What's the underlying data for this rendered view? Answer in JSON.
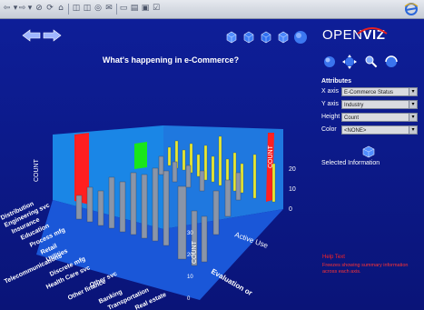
{
  "colors": {
    "background": "#0b1a8c",
    "wall_back": "#1d8fe8",
    "floor": "#1556d6",
    "red_block": "#ff1a1a",
    "green_block": "#19e61a",
    "yellow_bar": "#e8ea3a",
    "gray_bar": "#8a95a8",
    "help_red": "#ff2222"
  },
  "toolbar": {
    "back_icon": "back-arrow-icon",
    "forward_icon": "forward-arrow-icon",
    "stop_icon": "stop-icon",
    "refresh_icon": "refresh-icon",
    "home_icon": "home-icon",
    "search_icon": "search-icon",
    "favorites_icon": "favorites-icon",
    "history_icon": "history-icon",
    "mail_icon": "mail-icon",
    "print_icon": "print-icon",
    "edit_icon": "edit-icon",
    "browser_icon": "internet-explorer-icon"
  },
  "nav": {
    "left_icon": "nav-back-arrow-icon",
    "right_icon": "nav-forward-arrow-icon"
  },
  "chart": {
    "title": "What's happening in e-Commerce?",
    "axis_labels": {
      "count_left": "COUNT",
      "count_right": "COUNT",
      "count_front": "COUNT"
    },
    "tick_labels_right": [
      "20",
      "10",
      "0"
    ],
    "tick_labels_front": [
      "30",
      "20",
      "10",
      "0"
    ],
    "row_labels": [
      "Distribution",
      "Engineering svc",
      "Insurance",
      "Education",
      "Process mfg",
      "Retail",
      "Utilities",
      "Telecommunications",
      "Discrete mfg",
      "Health Care svc",
      "Other svc",
      "Other finance",
      "Banking",
      "Transportation",
      "Real estate"
    ],
    "depth_labels": [
      "Active Use",
      "Evaluation or"
    ]
  },
  "view_icons": [
    "view-cube-icon-1",
    "view-cube-icon-2",
    "view-cube-icon-3",
    "view-cube-icon-4",
    "view-sphere-icon"
  ],
  "nav_icons": [
    "sphere-icon",
    "move-icon",
    "zoom-icon",
    "rotate-icon"
  ],
  "brand": {
    "open": "OPEN",
    "viz": "VIZ"
  },
  "attributes": {
    "heading": "Attributes",
    "rows": [
      {
        "label": "X axis",
        "value": "E-Commerce Status"
      },
      {
        "label": "Y axis",
        "value": "Industry"
      },
      {
        "label": "Height",
        "value": "Count"
      },
      {
        "label": "Color",
        "value": "<NONE>"
      }
    ]
  },
  "selected_info": {
    "icon": "selected-info-icon",
    "label": "Selected Information"
  },
  "help": {
    "title": "Help Text",
    "body": "Freezes showing summary information across each axis."
  }
}
